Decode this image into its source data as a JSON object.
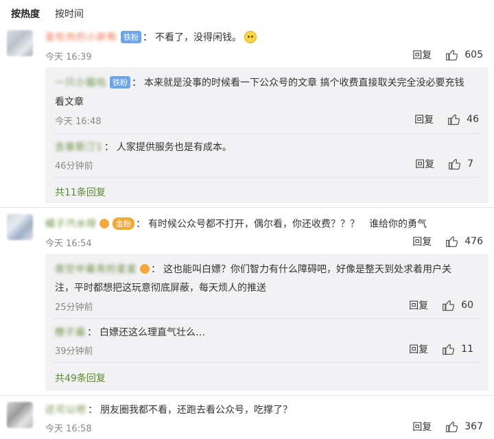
{
  "sort_tabs": {
    "hot": "按热度",
    "time": "按时间"
  },
  "common": {
    "reply_label": "回复",
    "colon": "："
  },
  "comments": [
    {
      "user": "爱吃肉的小胖熊",
      "badge": "铁粉",
      "text": "不看了，没得闲钱。",
      "time": "今天 16:39",
      "likes": "605",
      "replies": [
        {
          "user": "一只小猫咕",
          "badge": "铁粉",
          "text_line1": "本来就是没事的时候看一下公众号的文章 搞个收费直接取关完全没必要充钱",
          "text_line2": "看文章",
          "time": "今天 16:48",
          "likes": "46"
        },
        {
          "user": "吉普斯汀1",
          "text": "人家提供服务也是有成本。",
          "time": "46分钟前",
          "likes": "7"
        }
      ],
      "more": "共11条回复"
    },
    {
      "user": "橘子汽水呀",
      "badge": "金粉",
      "text": "有时候公众号都不打开，偶尔看，你还收费？？？　谁给你的勇气",
      "time": "今天 16:54",
      "likes": "476",
      "replies": [
        {
          "user": "夜空中最亮的星星",
          "text_line1": "这也能叫白嫖？你们智力有什么障碍吧，好像是整天到处求着用户关",
          "text_line2": "注，平时都想把这玩意彻底屏蔽，每天烦人的推送",
          "time": "25分钟前",
          "likes": "60"
        },
        {
          "user": "橙子酱",
          "text": "白嫖还这么理直气壮么…",
          "time": "39分钟前",
          "likes": "11"
        }
      ],
      "more": "共49条回复"
    },
    {
      "user": "还可以吧",
      "text": "朋友圈我都不看，还跑去看公众号，吃撑了？",
      "time": "今天 16:58",
      "likes": "367"
    }
  ]
}
